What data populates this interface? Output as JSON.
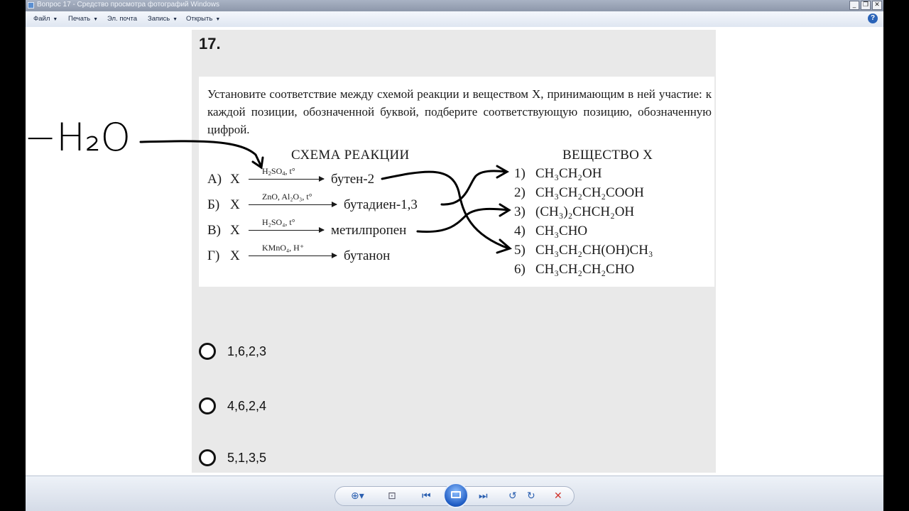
{
  "window": {
    "title": "Вопрос 17 - Средство просмотра фотографий Windows",
    "minimize": "_",
    "maximize": "❐",
    "close": "✕"
  },
  "menu": [
    {
      "label": "Файл",
      "dropdown": "▼"
    },
    {
      "label": "Печать",
      "dropdown": "▼"
    },
    {
      "label": "Эл. почта",
      "dropdown": ""
    },
    {
      "label": "Запись",
      "dropdown": "▼"
    },
    {
      "label": "Открыть",
      "dropdown": "▼"
    }
  ],
  "help_label": "?",
  "question": {
    "number": "17.",
    "task_text": "Установите соответствие между схемой реакции и веществом X, принимающим в ней участие: к каждой позиции, обозначенной буквой, подберите соответствующую позицию, обозначенную цифрой.",
    "left_header": "СХЕМА РЕАКЦИИ",
    "right_header": "ВЕЩЕСТВО X",
    "reactions": [
      {
        "letter": "А)",
        "reagent": "X",
        "cond_main": "H",
        "cond_sub": "2",
        "cond_rest": "SO",
        "cond_sub2": "4",
        "cond_tail": ", t°",
        "product": "бутен-2"
      },
      {
        "letter": "Б)",
        "reagent": "X",
        "cond_text": "ZnO, Al₂O₃, t°",
        "product": "бутадиен-1,3"
      },
      {
        "letter": "В)",
        "reagent": "X",
        "cond_text": "H₂SO₄, t°",
        "product": "метилпропен"
      },
      {
        "letter": "Г)",
        "reagent": "X",
        "cond_text": "KMnO₄, H⁺",
        "product": "бутанон"
      }
    ],
    "substances": [
      {
        "num": "1)",
        "formula": "CH₃CH₂OH"
      },
      {
        "num": "2)",
        "formula": "CH₃CH₂CH₂COOH"
      },
      {
        "num": "3)",
        "formula": "(CH₃)₂CHCH₂OH"
      },
      {
        "num": "4)",
        "formula": "CH₃CHO"
      },
      {
        "num": "5)",
        "formula": "CH₃CH₂CH(OH)CH₃"
      },
      {
        "num": "6)",
        "formula": "CH₃CH₂CH₂CHO"
      }
    ],
    "options": [
      "1,6,2,3",
      "4,6,2,4",
      "5,1,3,5"
    ]
  },
  "annotation": {
    "handwritten": "−H₂O",
    "ink_color": "#000000"
  },
  "toolbar": {
    "zoom": "⊕▾",
    "fit": "⊡",
    "prev": "⏮",
    "next": "⏭",
    "rotate_ccw": "↺",
    "rotate_cw": "↻",
    "delete": "✕"
  },
  "colors": {
    "accent": "#2a5fb0",
    "delete": "#d0342c",
    "sheet": "#e9e9e9"
  }
}
